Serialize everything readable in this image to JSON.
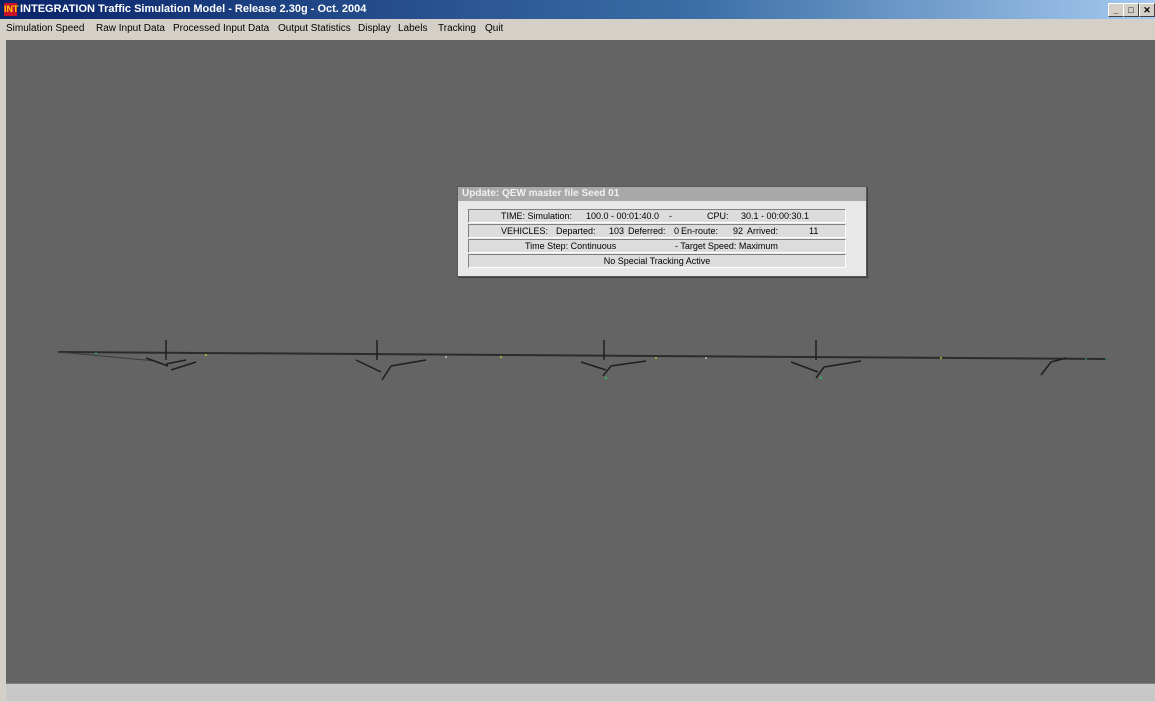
{
  "window": {
    "icon_text": "INT",
    "title": "INTEGRATION Traffic Simulation Model - Release 2.30g - Oct. 2004",
    "controls": {
      "minimize": "_",
      "maximize": "□",
      "close": "✕"
    }
  },
  "menu": [
    "Simulation Speed",
    "Raw Input Data",
    "Processed Input Data",
    "Output Statistics",
    "Display",
    "Labels",
    "Tracking",
    "Quit"
  ],
  "panel": {
    "title": "Update: QEW master file Seed 01",
    "time": {
      "label": "TIME: Simulation:",
      "sim": "100.0 - 00:01:40.0",
      "sep": "-",
      "cpu_label": "CPU:",
      "cpu": "30.1 - 00:00:30.1"
    },
    "vehicles": {
      "label": "VEHICLES:",
      "departed_label": "Departed:",
      "departed": "103",
      "deferred_label": "Deferred:",
      "deferred": "0",
      "enroute_label": "En-route:",
      "enroute": "92",
      "arrived_label": "Arrived:",
      "arrived": "11"
    },
    "timestep": {
      "text": "Time Step: Continuous",
      "speed": "- Target Speed: Maximum"
    },
    "tracking": "No Special Tracking Active"
  },
  "colors": {
    "title_bar": "#0a246a",
    "canvas": "#646464",
    "road": "#2b2b2b"
  }
}
